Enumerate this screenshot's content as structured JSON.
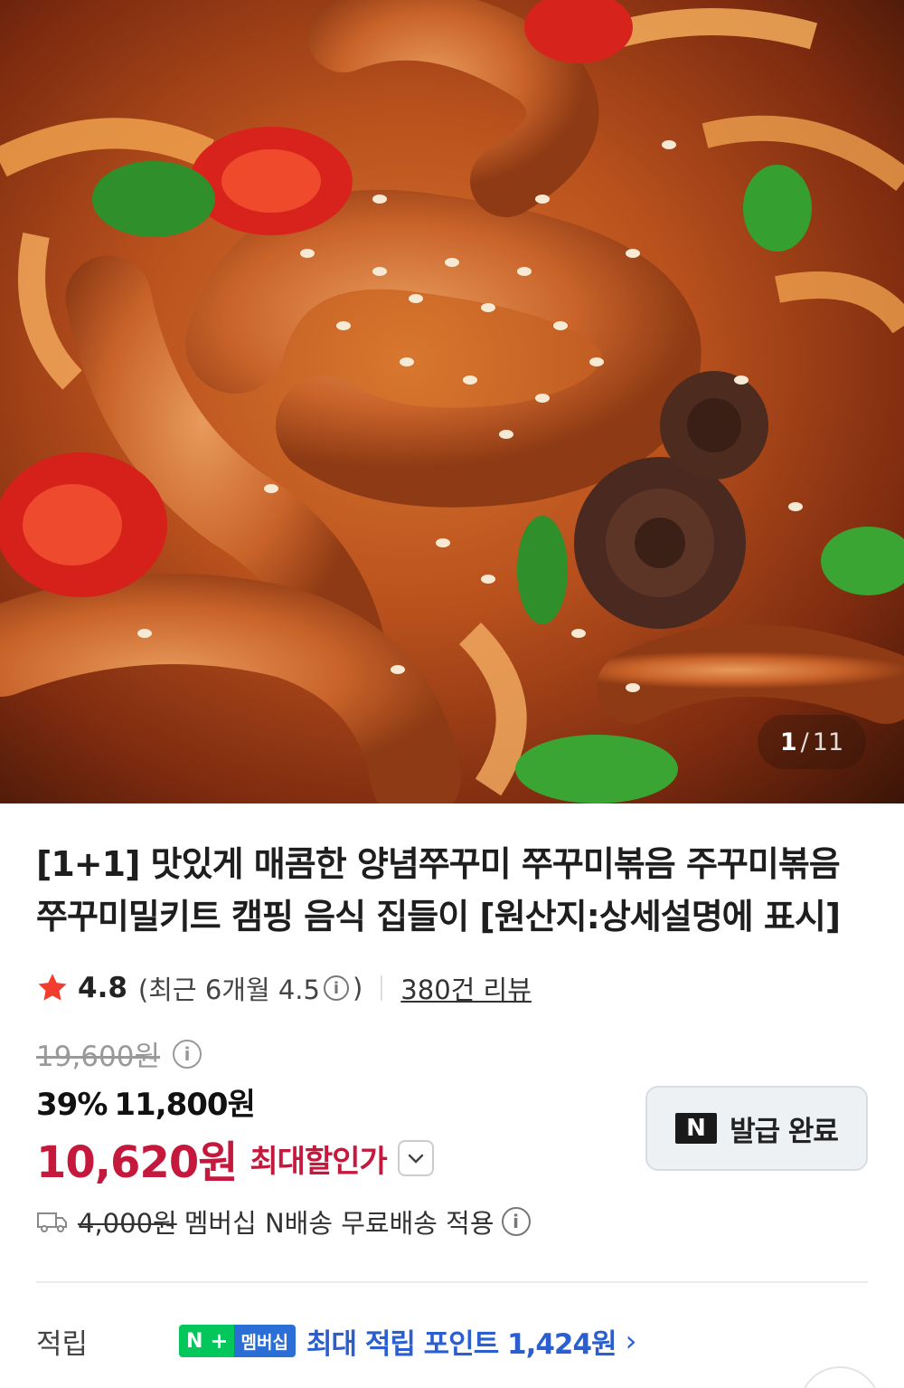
{
  "hero": {
    "image_label": "spicy stir-fried webfoot octopus photo",
    "counter_current": "1",
    "counter_sep": "/",
    "counter_total": "11"
  },
  "product": {
    "title": "[1+1] 맛있게 매콤한 양념쭈꾸미 쭈꾸미볶음 주꾸미볶음 쭈꾸미밀키트 캠핑 음식 집들이 [원산지:상세설명에 표시]"
  },
  "rating": {
    "score": "4.8",
    "recent": "(최근 6개월 4.5",
    "recent_close": ")",
    "reviews": "380건 리뷰",
    "star_color": "#f23d2e"
  },
  "price": {
    "original": "19,600원",
    "discount_pct": "39%",
    "sale": "11,800원",
    "final": "10,620원",
    "final_label": "최대할인가",
    "accent_color": "#c4183c"
  },
  "coupon": {
    "badge": "N",
    "label": "발급 완료"
  },
  "shipping": {
    "fee": "4,000원",
    "text": "멤버십 N배송 무료배송 적용"
  },
  "points": {
    "label": "적립",
    "badge_n": "N",
    "badge_plus": "+",
    "badge_member": "멤버십",
    "text": "최대 적립 포인트 1,424원",
    "chevron": "›",
    "accent_color": "#2b5fd0"
  },
  "info_glyph": "i"
}
